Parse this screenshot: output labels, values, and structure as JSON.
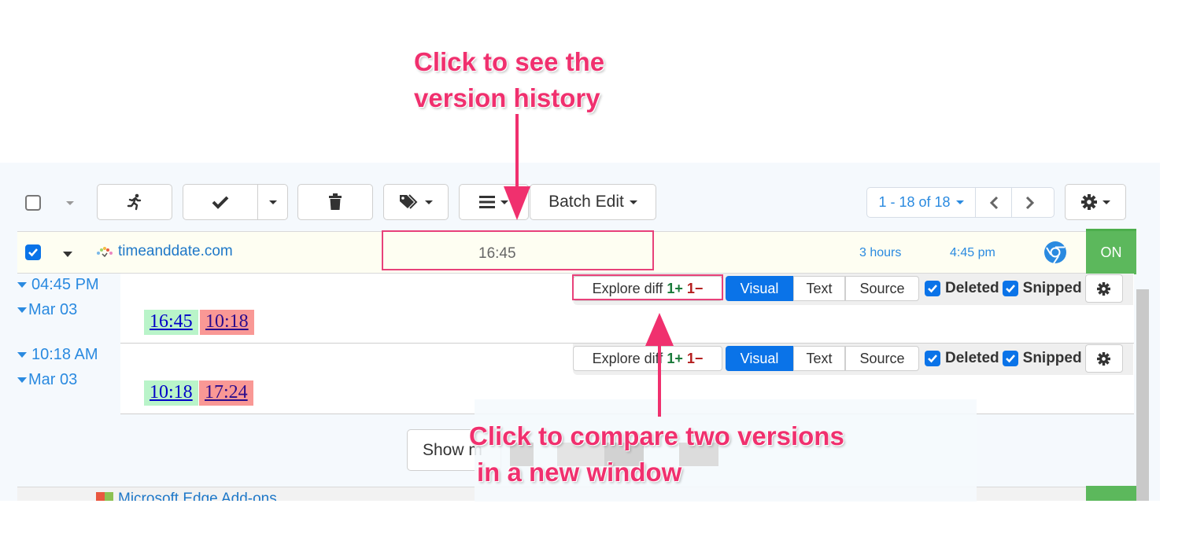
{
  "toolbar": {
    "batch_edit_label": "Batch Edit",
    "pagination": {
      "range_label": "1 - 18 of 18",
      "prev_label": "‹",
      "next_label": "›"
    },
    "icons": [
      "select-all-checkbox",
      "run-icon",
      "check-icon",
      "trash-icon",
      "tags-icon",
      "list-icon",
      "gear-icon"
    ]
  },
  "monitor": {
    "selected": true,
    "name": "timeanddate.com",
    "current_value": "16:45",
    "interval": "3 hours",
    "last_checked": "4:45 pm",
    "browser": "chrome",
    "status": "ON",
    "status_color": "#5cb85c"
  },
  "versions": [
    {
      "time": "04:45 PM",
      "date": "Mar 03",
      "added": "16:45",
      "removed": "10:18",
      "explore_label": "Explore diff",
      "added_count": "1+",
      "removed_count": "1−",
      "modes": [
        "Visual",
        "Text",
        "Source"
      ],
      "active_mode": "Visual",
      "deleted_label": "Deleted",
      "deleted_checked": true,
      "snipped_label": "Snipped",
      "snipped_checked": true
    },
    {
      "time": "10:18 AM",
      "date": "Mar 03",
      "added": "10:18",
      "removed": "17:24",
      "explore_label": "Explore diff",
      "added_count": "1+",
      "removed_count": "1−",
      "modes": [
        "Visual",
        "Text",
        "Source"
      ],
      "active_mode": "Visual",
      "deleted_label": "Deleted",
      "deleted_checked": true,
      "snipped_label": "Snipped",
      "snipped_checked": true
    }
  ],
  "show_more_label": "Show m",
  "next_monitor_name": "Microsoft Edge Add-ons",
  "annotations": {
    "top_line1": "Click to see the",
    "top_line2": "version history",
    "bottom_line1": "Click to compare two versions",
    "bottom_line2": "in a new window"
  },
  "colors": {
    "accent": "#2a8ae0",
    "primary_button": "#0a73e8",
    "added_bg": "#b9f4c9",
    "removed_bg": "#f99895",
    "annotation": "#f0306e"
  }
}
